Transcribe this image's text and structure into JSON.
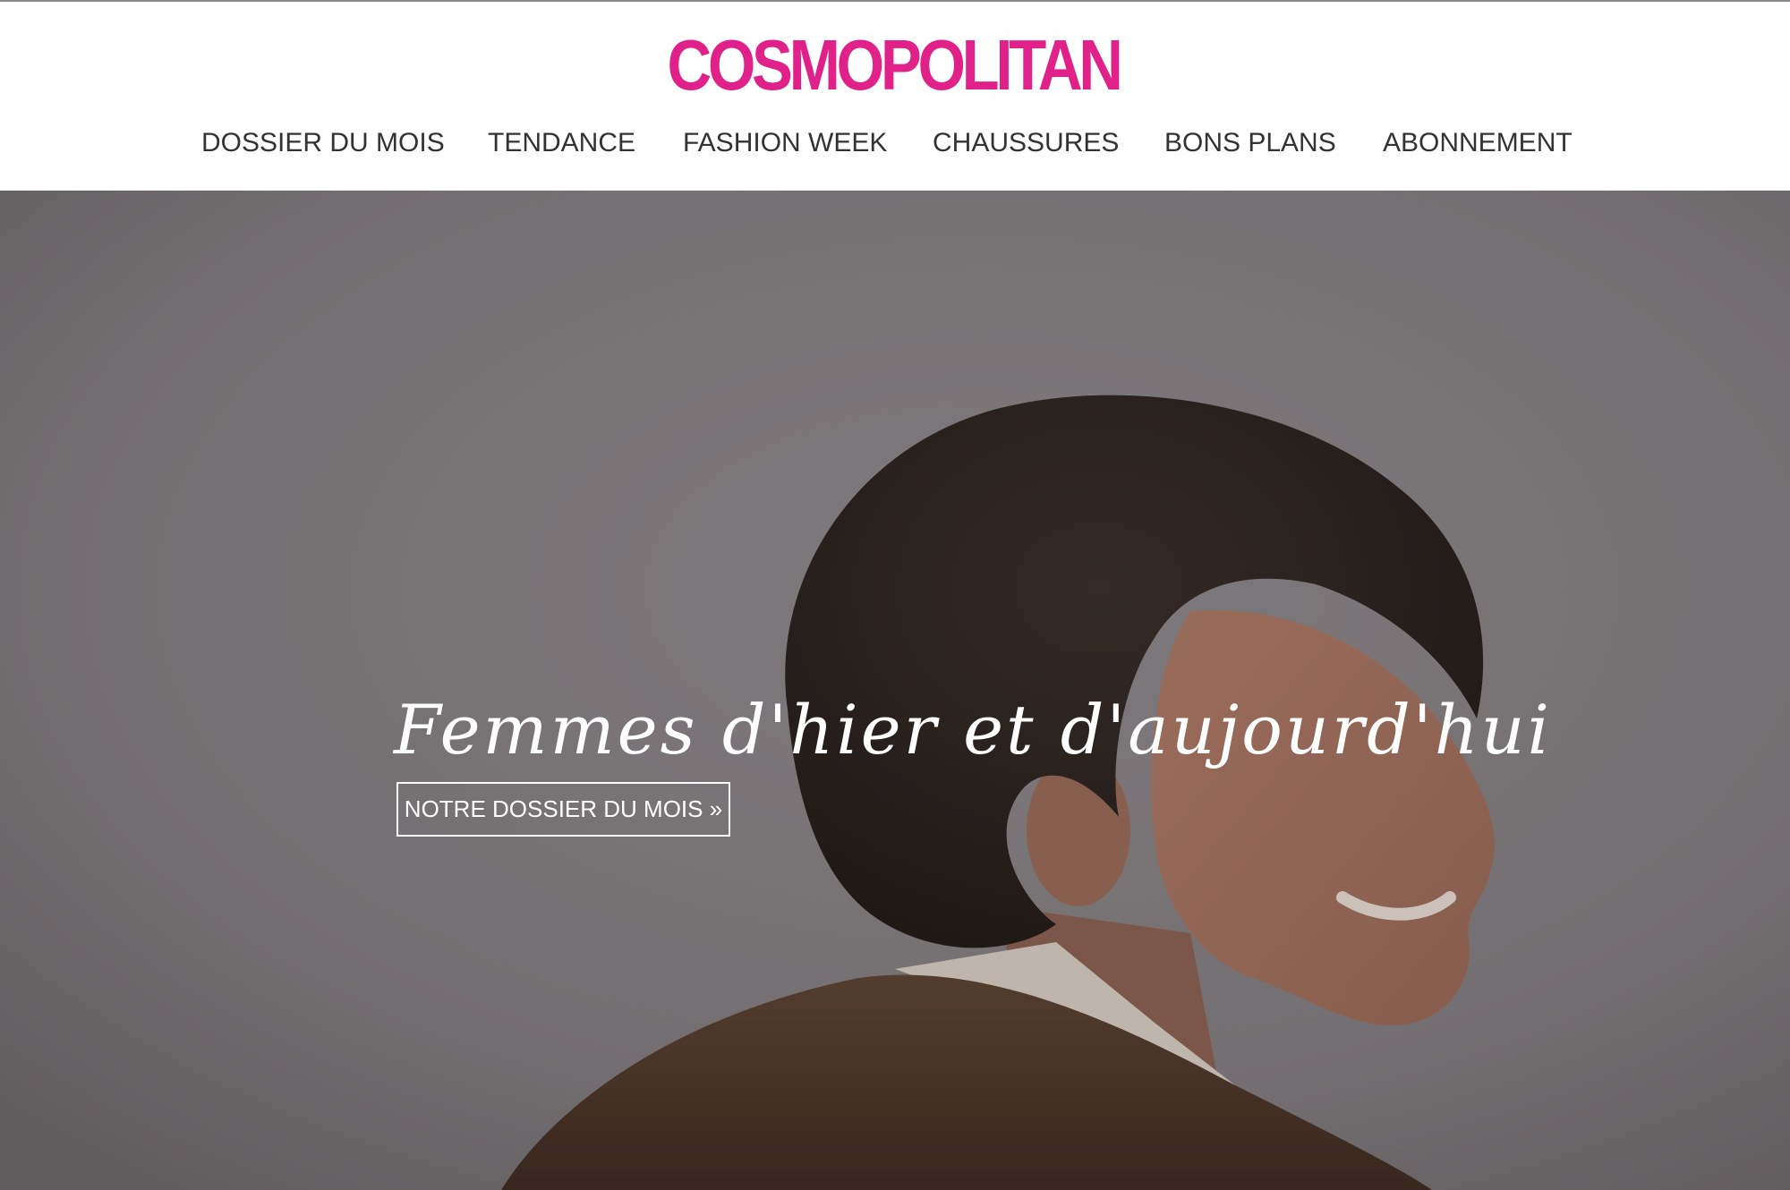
{
  "brand": {
    "logo_text": "COSMOPOLITAN",
    "color": "#e0218a"
  },
  "nav": {
    "items": [
      {
        "label": "DOSSIER DU MOIS"
      },
      {
        "label": "TENDANCE"
      },
      {
        "label": "FASHION WEEK"
      },
      {
        "label": "CHAUSSURES"
      },
      {
        "label": "BONS PLANS"
      },
      {
        "label": "ABONNEMENT"
      }
    ]
  },
  "hero": {
    "headline": "Femmes d'hier et d'aujourd'hui",
    "cta_label": "NOTRE DOSSIER DU MOIS »",
    "overlay_color": "#858083"
  }
}
